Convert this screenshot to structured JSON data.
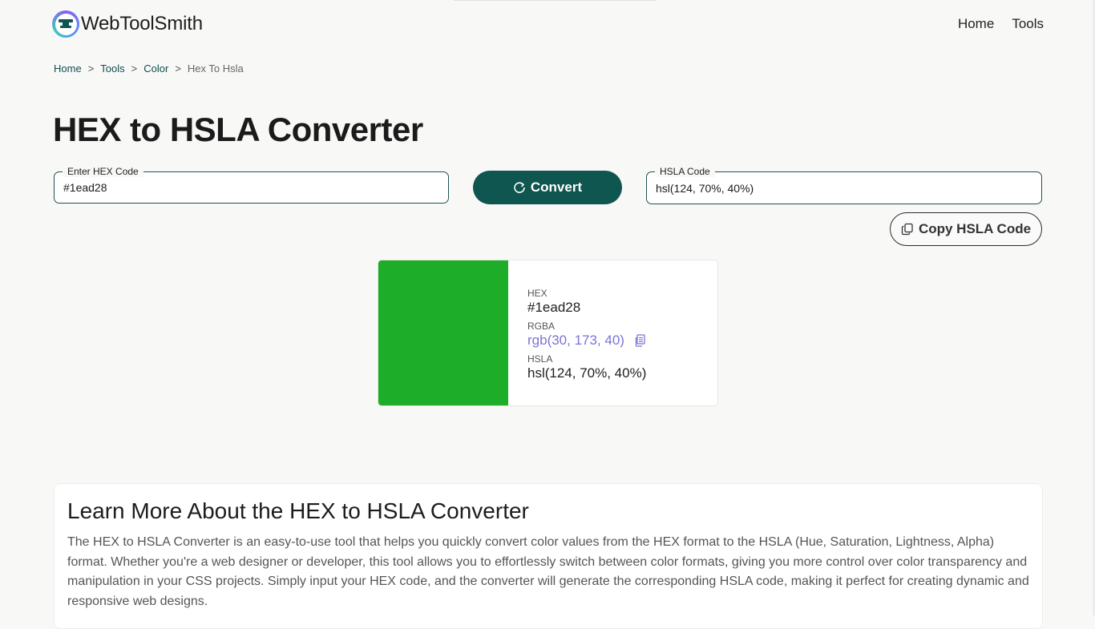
{
  "brand": {
    "name": "WebToolSmith"
  },
  "nav": {
    "home": "Home",
    "tools": "Tools"
  },
  "breadcrumb": {
    "home": "Home",
    "tools": "Tools",
    "color": "Color",
    "current": "Hex To Hsla",
    "separator": ">"
  },
  "page": {
    "title": "HEX to HSLA Converter"
  },
  "hex_input": {
    "label": "Enter HEX Code",
    "value": "#1ead28"
  },
  "convert_button": {
    "label": "Convert"
  },
  "hsla_output": {
    "label": "HSLA Code",
    "value": "hsl(124, 70%, 40%)"
  },
  "copy_button": {
    "label": "Copy HSLA Code"
  },
  "color_card": {
    "swatch_color": "#1ead28",
    "hex_label": "HEX",
    "hex_value": "#1ead28",
    "rgba_label": "RGBA",
    "rgba_value": "rgb(30, 173, 40)",
    "hsla_label": "HSLA",
    "hsla_value": "hsl(124, 70%, 40%)"
  },
  "learn_more": {
    "title": "Learn More About the HEX to HSLA Converter",
    "body": "The HEX to HSLA Converter is an easy-to-use tool that helps you quickly convert color values from the HEX format to the HSLA (Hue, Saturation, Lightness, Alpha) format. Whether you're a web designer or developer, this tool allows you to effortlessly switch between color formats, giving you more control over color transparency and manipulation in your CSS projects. Simply input your HEX code, and the converter will generate the corresponding HSLA code, making it perfect for creating dynamic and responsive web designs."
  },
  "colors": {
    "accent": "#0f5550",
    "link": "#7a73d9",
    "breadcrumb_link": "#0f4f4f"
  },
  "icons": {
    "logo": "anvil-icon",
    "convert": "refresh-icon",
    "copy": "copy-icon",
    "rgba_copy": "clipboard-icon"
  }
}
